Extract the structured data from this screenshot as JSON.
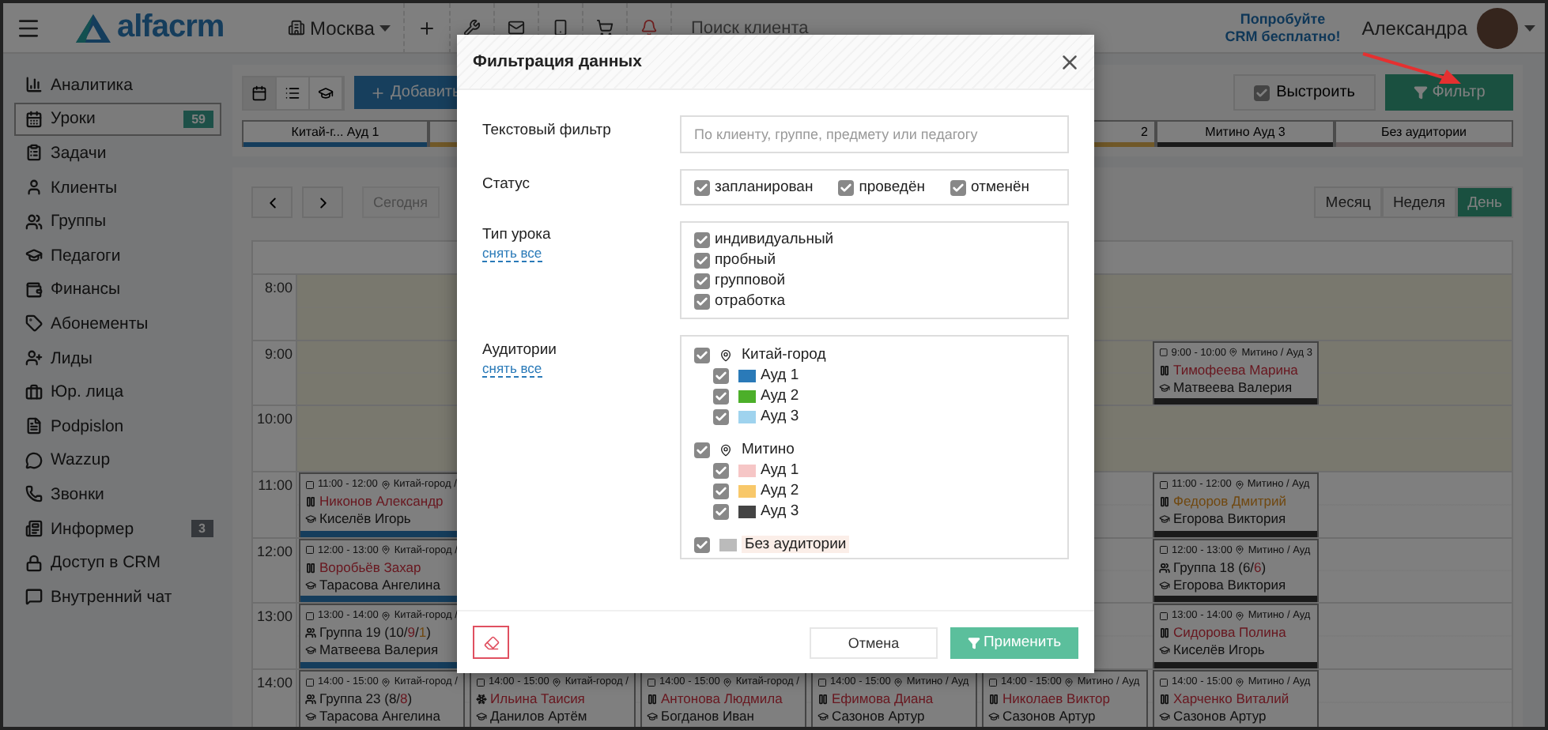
{
  "header": {
    "logo": "alfacrm",
    "branch": "Москва",
    "search_placeholder": "Поиск клиента",
    "promo": "Попробуйте CRM бесплатно!",
    "user": "Александра"
  },
  "sidebar": {
    "items": [
      {
        "label": "Аналитика",
        "selected": false
      },
      {
        "label": "Уроки",
        "selected": true,
        "badge": "59"
      },
      {
        "label": "Задачи",
        "selected": false
      },
      {
        "label": "Клиенты",
        "selected": false
      },
      {
        "label": "Группы",
        "selected": false
      },
      {
        "label": "Педагоги",
        "selected": false
      },
      {
        "label": "Финансы",
        "selected": false
      },
      {
        "label": "Абонементы",
        "selected": false
      },
      {
        "label": "Лиды",
        "selected": false
      },
      {
        "label": "Юр. лица",
        "selected": false
      },
      {
        "label": "Podpislon",
        "selected": false
      },
      {
        "label": "Wazzup",
        "selected": false
      },
      {
        "label": "Звонки",
        "selected": false
      },
      {
        "label": "Информер",
        "selected": false,
        "badge": "3"
      },
      {
        "label": "Доступ в CRM",
        "selected": false
      },
      {
        "label": "Внутренний чат",
        "selected": false
      }
    ]
  },
  "toolbar": {
    "views": [
      {
        "selected": true
      },
      {
        "selected": false
      },
      {
        "selected": false
      }
    ],
    "add_button": "Добавить",
    "arrange": {
      "label": "Выстроить",
      "checked": true
    },
    "filter_button": "Фильтр",
    "room_tabs": [
      {
        "label": "Китай-г... Ауд 1",
        "color": "#153d5c"
      },
      {
        "label": "2",
        "color": "#705828"
      },
      {
        "label": "Митино Ауд 3",
        "color": "#1a1a1a"
      },
      {
        "label": "Без аудитории",
        "color": "#645c5c"
      }
    ]
  },
  "calendar": {
    "today": "Сегодня",
    "views": [
      {
        "label": "Месяц",
        "selected": false
      },
      {
        "label": "Неделя",
        "selected": false
      },
      {
        "label": "День",
        "selected": true
      }
    ],
    "rows": [
      {
        "hour": "8:00"
      },
      {
        "hour": "9:00",
        "cells": [
          {
            "kind": "free"
          },
          {
            "kind": "free"
          },
          {
            "kind": "free"
          },
          {
            "kind": "free"
          },
          {
            "kind": "free"
          },
          {
            "kind": "individual",
            "time": "9:00 - 10:00",
            "location": "Митино / Ауд 3",
            "title": [
              {
                "text": "Тимофеева Марина",
                "kind": "alert"
              }
            ],
            "teacher": "Матвеева Валерия",
            "color": "#1a1a1a"
          }
        ]
      },
      {
        "hour": "10:00"
      },
      {
        "hour": "11:00",
        "cells": [
          {
            "kind": "individual",
            "time": "11:00 - 12:00",
            "location": "Китай-город /",
            "title": [
              {
                "text": "Никонов Александр",
                "kind": "alert"
              }
            ],
            "teacher": "Киселёв Игорь",
            "color": "#153d5c"
          },
          {
            "kind": "free"
          },
          {
            "kind": "free"
          },
          {
            "kind": "free"
          },
          {
            "kind": "free"
          },
          {
            "kind": "individual",
            "time": "11:00 - 12:00",
            "location": "Митино / Ауд",
            "title": [
              {
                "text": "Федоров Дмитрий",
                "kind": "warning"
              }
            ],
            "teacher": "Егорова Виктория",
            "color": "#1a1a1a"
          }
        ]
      },
      {
        "hour": "12:00",
        "cells": [
          {
            "kind": "individual",
            "time": "12:00 - 13:00",
            "location": "Китай-город /",
            "title": [
              {
                "text": "Воробьёв Захар",
                "kind": "alert"
              }
            ],
            "teacher": "Тарасова Ангелина",
            "color": "#153d5c"
          },
          {
            "kind": "free"
          },
          {
            "kind": "free"
          },
          {
            "kind": "free"
          },
          {
            "kind": "free"
          },
          {
            "kind": "group",
            "time": "12:00 - 13:00",
            "location": "Митино / Ауд",
            "title": [
              {
                "text": "Группа 18 (6/",
                "kind": "plain"
              },
              {
                "text": "6",
                "kind": "alert"
              },
              {
                "text": ")",
                "kind": "plain"
              }
            ],
            "teacher": "Егорова Виктория",
            "color": "#1a1a1a"
          }
        ]
      },
      {
        "hour": "13:00",
        "cells": [
          {
            "kind": "group",
            "time": "13:00 - 14:00",
            "location": "Китай-город /",
            "title": [
              {
                "text": "Группа 19 (10/",
                "kind": "plain"
              },
              {
                "text": "9",
                "kind": "alert"
              },
              {
                "text": "/",
                "kind": "plain"
              },
              {
                "text": "1",
                "kind": "warning"
              },
              {
                "text": ")",
                "kind": "plain"
              }
            ],
            "teacher": "Матвеева Валерия",
            "color": "#153d5c"
          },
          {
            "kind": "free"
          },
          {
            "kind": "free"
          },
          {
            "kind": "free"
          },
          {
            "kind": "free"
          },
          {
            "kind": "individual",
            "time": "13:00 - 14:00",
            "location": "Митино / Ауд",
            "title": [
              {
                "text": "Сидорова Полина",
                "kind": "alert"
              }
            ],
            "teacher": "Киселёв Игорь",
            "color": "#1a1a1a"
          }
        ]
      },
      {
        "hour": "14:00",
        "cells": [
          {
            "kind": "group",
            "time": "14:00 - 15:00",
            "location": "Китай-город /",
            "title": [
              {
                "text": "Группа 23 (8/",
                "kind": "plain"
              },
              {
                "text": "8",
                "kind": "alert"
              },
              {
                "text": ")",
                "kind": "plain"
              }
            ],
            "teacher": "Тарасова Ангелина"
          },
          {
            "kind": "trial",
            "time": "14:00 - 15:00",
            "location": "Китай-город /",
            "title": [
              {
                "text": "Ильина Таисия",
                "kind": "alert"
              }
            ],
            "teacher": "Данилов Артём"
          },
          {
            "kind": "individual",
            "time": "14:00 - 15:00",
            "location": "Китай-город /",
            "title": [
              {
                "text": "Антонова Людмила",
                "kind": "alert"
              }
            ],
            "teacher": "Богданов Иван"
          },
          {
            "kind": "individual",
            "time": "14:00 - 15:00",
            "location": "Митино / Ауд",
            "title": [
              {
                "text": "Ефимова Диана",
                "kind": "alert"
              }
            ],
            "teacher": "Сазонов Артур"
          },
          {
            "kind": "individual",
            "time": "14:00 - 15:00",
            "location": "Митино / Ауд",
            "title": [
              {
                "text": "Николаев Виктор",
                "kind": "alert"
              }
            ],
            "teacher": "Сазонов Артур"
          },
          {
            "kind": "individual",
            "time": "14:00 - 15:00",
            "location": "Митино / Ауд",
            "title": [
              {
                "text": "Харченко Виталий",
                "kind": "alert"
              }
            ],
            "teacher": "Сазонов Артур"
          }
        ]
      }
    ]
  },
  "modal": {
    "title": "Фильтрация данных",
    "text_filter": {
      "label": "Текстовый фильтр",
      "placeholder": "По клиенту, группе, предмету или педагогу"
    },
    "status": {
      "label": "Статус",
      "options": [
        {
          "label": "запланирован",
          "checked": true
        },
        {
          "label": "проведён",
          "checked": true
        },
        {
          "label": "отменён",
          "checked": true
        }
      ]
    },
    "lesson_type": {
      "label": "Тип урока",
      "clear_link": "снять все",
      "options": [
        {
          "label": "индивидуальный",
          "checked": true
        },
        {
          "label": "пробный",
          "checked": true
        },
        {
          "label": "групповой",
          "checked": true
        },
        {
          "label": "отработка",
          "checked": true
        }
      ]
    },
    "rooms": {
      "label": "Аудитории",
      "clear_link": "снять все",
      "branches": [
        {
          "label": "Китай-город",
          "checked": true,
          "children": [
            {
              "label": "Ауд 1",
              "checked": true,
              "color": "#2a7ab8"
            },
            {
              "label": "Ауд 2",
              "checked": true,
              "color": "#4caf2a"
            },
            {
              "label": "Ауд 3",
              "checked": true,
              "color": "#9fd3ee"
            }
          ]
        },
        {
          "label": "Митино",
          "checked": true,
          "children": [
            {
              "label": "Ауд 1",
              "checked": true,
              "color": "#f6c6c6"
            },
            {
              "label": "Ауд 2",
              "checked": true,
              "color": "#f8c86a"
            },
            {
              "label": "Ауд 3",
              "checked": true,
              "color": "#444444"
            }
          ]
        }
      ],
      "no_room": {
        "label": "Без аудитории",
        "checked": true,
        "color": "#bbbbbb"
      }
    },
    "cancel_button": "Отмена",
    "apply_button": "Применить"
  }
}
